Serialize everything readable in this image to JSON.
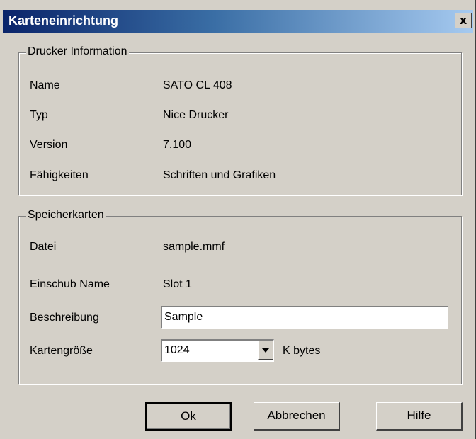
{
  "window": {
    "title": "Karteneinrichtung",
    "close_label": "x"
  },
  "printer_info": {
    "legend": "Drucker Information",
    "rows": [
      {
        "label": "Name",
        "value": "SATO CL 408"
      },
      {
        "label": "Typ",
        "value": "Nice Drucker"
      },
      {
        "label": "Version",
        "value": "7.100"
      },
      {
        "label": "Fähigkeiten",
        "value": "Schriften und Grafiken"
      }
    ]
  },
  "memory_card": {
    "legend": "Speicherkarten",
    "file_label": "Datei",
    "file_value": "sample.mmf",
    "slot_label": "Einschub Name",
    "slot_value": "Slot 1",
    "desc_label": "Beschreibung",
    "desc_value": "Sample",
    "size_label": "Kartengröße",
    "size_value": "1024",
    "size_unit": "K bytes"
  },
  "buttons": {
    "ok": "Ok",
    "cancel": "Abbrechen",
    "help": "Hilfe"
  },
  "colors": {
    "title_start": "#0a246a",
    "title_end": "#a6caf0",
    "face": "#d4d0c8"
  }
}
